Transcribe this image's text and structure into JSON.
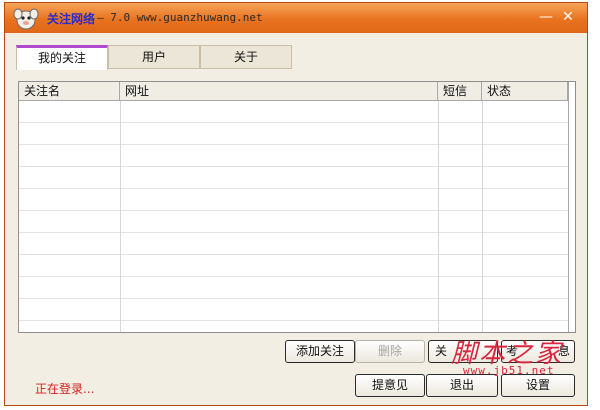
{
  "window": {
    "title_name": "关注网络",
    "title_rest": "— 7.0 www.guanzhuwang.net",
    "minimize_glyph": "—",
    "close_glyph": "✕"
  },
  "tabs": [
    {
      "label": "我的关注",
      "active": true
    },
    {
      "label": "用户",
      "active": false
    },
    {
      "label": "关于",
      "active": false
    }
  ],
  "table": {
    "columns": [
      "关注名",
      "网址",
      "短信",
      "状态"
    ],
    "rows": []
  },
  "buttons": {
    "add_follow": "添加关注",
    "delete": "删除",
    "link_partial": "关",
    "history_partial": "考",
    "history_end": "息",
    "feedback": "提意见",
    "exit": "退出",
    "settings": "设置"
  },
  "status_text": "正在登录...",
  "watermark": {
    "text": "脚本之家",
    "url": "www.jb51.net",
    "color": "#d8263e"
  },
  "colors": {
    "titlebar": "#e8731f",
    "title_name": "#2c2cc8",
    "active_tab_accent": "#b14ad1",
    "status_text": "#d42222"
  }
}
